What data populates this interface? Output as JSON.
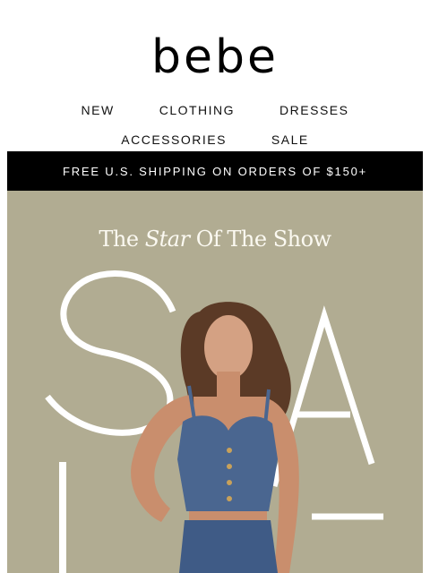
{
  "brand": {
    "logo_text": "bebe"
  },
  "nav": {
    "row1": [
      "NEW",
      "CLOTHING",
      "DRESSES"
    ],
    "row2": [
      "ACCESSORIES",
      "SALE"
    ]
  },
  "banner": {
    "text": "FREE U.S. SHIPPING ON ORDERS OF $150+"
  },
  "hero": {
    "title_pre": "The ",
    "title_em": "Star",
    "title_post": " Of The Show",
    "sale_letters": "SALE",
    "colors": {
      "background": "#b1ac92",
      "letters": "#ffffff",
      "denim": "#4a6690",
      "skin": "#c98e6d",
      "hair": "#5b3a26"
    }
  }
}
